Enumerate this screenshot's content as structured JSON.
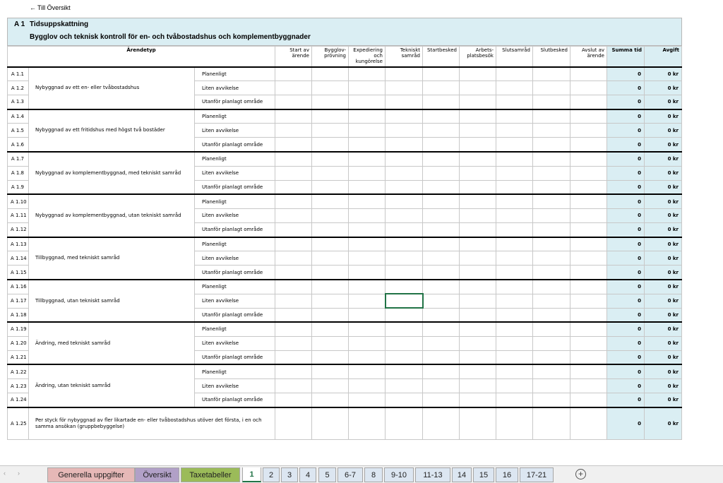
{
  "back_link": "Till Översikt",
  "header": {
    "code": "A 1",
    "title": "Tidsuppskattning",
    "subtitle": "Bygglov och teknisk kontroll för en- och tvåbostadshus och komplementbyggnader"
  },
  "columns": {
    "arendetyp": "Ärendetyp",
    "steps": [
      "Start av ärende",
      "Bygglov-prövning",
      "Expediering och kungörelse",
      "Tekniskt samråd",
      "Startbesked",
      "Arbets-platsbesök",
      "Slutsamråd",
      "Slutbesked",
      "Avslut av ärende"
    ],
    "sum": "Summa tid",
    "fee": "Avgift"
  },
  "groups": [
    {
      "desc": "Nybyggnad av ett en- eller tvåbostadshus",
      "rows": [
        {
          "code": "A 1.1",
          "variant": "Planenligt",
          "sum": "0",
          "fee": "0 kr"
        },
        {
          "code": "A 1.2",
          "variant": "Liten avvikelse",
          "sum": "0",
          "fee": "0 kr"
        },
        {
          "code": "A 1.3",
          "variant": "Utanför planlagt område",
          "sum": "0",
          "fee": "0 kr"
        }
      ]
    },
    {
      "desc": "Nybyggnad av ett fritidshus med högst två bostäder",
      "rows": [
        {
          "code": "A 1.4",
          "variant": "Planenligt",
          "sum": "0",
          "fee": "0 kr"
        },
        {
          "code": "A 1.5",
          "variant": "Liten avvikelse",
          "sum": "0",
          "fee": "0 kr"
        },
        {
          "code": "A 1.6",
          "variant": "Utanför planlagt område",
          "sum": "0",
          "fee": "0 kr"
        }
      ]
    },
    {
      "desc": "Nybyggnad av komplementbyggnad, med tekniskt samråd",
      "rows": [
        {
          "code": "A 1.7",
          "variant": "Planenligt",
          "sum": "0",
          "fee": "0 kr"
        },
        {
          "code": "A 1.8",
          "variant": "Liten avvikelse",
          "sum": "0",
          "fee": "0 kr"
        },
        {
          "code": "A 1.9",
          "variant": "Utanför planlagt område",
          "sum": "0",
          "fee": "0 kr"
        }
      ]
    },
    {
      "desc": "Nybyggnad av komplementbyggnad, utan tekniskt samråd",
      "rows": [
        {
          "code": "A 1.10",
          "variant": "Planenligt",
          "sum": "0",
          "fee": "0 kr"
        },
        {
          "code": "A 1.11",
          "variant": "Liten avvikelse",
          "sum": "0",
          "fee": "0 kr"
        },
        {
          "code": "A 1.12",
          "variant": "Utanför planlagt område",
          "sum": "0",
          "fee": "0 kr"
        }
      ]
    },
    {
      "desc": "Tillbyggnad, med tekniskt samråd",
      "rows": [
        {
          "code": "A 1.13",
          "variant": "Planenligt",
          "sum": "0",
          "fee": "0 kr"
        },
        {
          "code": "A 1.14",
          "variant": "Liten avvikelse",
          "sum": "0",
          "fee": "0 kr"
        },
        {
          "code": "A 1.15",
          "variant": "Utanför planlagt område",
          "sum": "0",
          "fee": "0 kr"
        }
      ]
    },
    {
      "desc": "Tillbyggnad, utan tekniskt samråd",
      "rows": [
        {
          "code": "A 1.16",
          "variant": "Planenligt",
          "sum": "0",
          "fee": "0 kr"
        },
        {
          "code": "A 1.17",
          "variant": "Liten avvikelse",
          "sum": "0",
          "fee": "0 kr"
        },
        {
          "code": "A 1.18",
          "variant": "Utanför planlagt område",
          "sum": "0",
          "fee": "0 kr"
        }
      ]
    },
    {
      "desc": "Ändring, med tekniskt samråd",
      "rows": [
        {
          "code": "A 1.19",
          "variant": "Planenligt",
          "sum": "0",
          "fee": "0 kr"
        },
        {
          "code": "A 1.20",
          "variant": "Liten avvikelse",
          "sum": "0",
          "fee": "0 kr"
        },
        {
          "code": "A 1.21",
          "variant": "Utanför planlagt område",
          "sum": "0",
          "fee": "0 kr"
        }
      ]
    },
    {
      "desc": "Ändring, utan tekniskt samråd",
      "rows": [
        {
          "code": "A 1.22",
          "variant": "Planenligt",
          "sum": "0",
          "fee": "0 kr"
        },
        {
          "code": "A 1.23",
          "variant": "Liten avvikelse",
          "sum": "0",
          "fee": "0 kr"
        },
        {
          "code": "A 1.24",
          "variant": "Utanför planlagt område",
          "sum": "0",
          "fee": "0 kr"
        }
      ]
    }
  ],
  "last_row": {
    "code": "A 1.25",
    "desc": "Per styck för nybyggnad av fler likartade en- eller tvåbostadshus utöver det första, i en och samma ansökan (gruppbebyggelse)",
    "sum": "0",
    "fee": "0 kr"
  },
  "tabs": [
    {
      "label": "Generella uppgifter",
      "color": "#e6b8b7"
    },
    {
      "label": "Översikt",
      "color": "#b1a0c7"
    },
    {
      "label": "Taxetabeller",
      "color": "#9bbb59"
    },
    {
      "label": "1",
      "color": "#ffffff",
      "active": true
    },
    {
      "label": "2",
      "color": "#dce6f1"
    },
    {
      "label": "3",
      "color": "#dce6f1"
    },
    {
      "label": "4",
      "color": "#dce6f1"
    },
    {
      "label": "5",
      "color": "#dce6f1"
    },
    {
      "label": "6-7",
      "color": "#dce6f1"
    },
    {
      "label": "8",
      "color": "#dce6f1"
    },
    {
      "label": "9-10",
      "color": "#dce6f1"
    },
    {
      "label": "11-13",
      "color": "#dce6f1"
    },
    {
      "label": "14",
      "color": "#dce6f1"
    },
    {
      "label": "15",
      "color": "#dce6f1"
    },
    {
      "label": "16",
      "color": "#dce6f1"
    },
    {
      "label": "17-21",
      "color": "#dce6f1"
    }
  ],
  "selected_cell": {
    "row": "A 1.17",
    "column": "Tekniskt samråd"
  }
}
